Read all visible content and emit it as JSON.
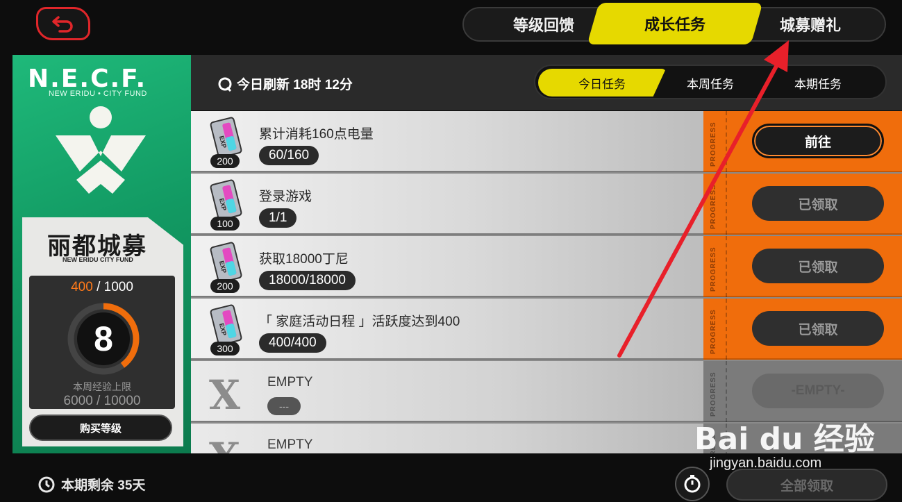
{
  "colors": {
    "accent_yellow": "#e6d900",
    "orange": "#f06d0c",
    "green": "#129a63",
    "arrow_red": "#e8202a"
  },
  "top_tabs": [
    {
      "label": "等级回馈",
      "active": false
    },
    {
      "label": "成长任务",
      "active": true
    },
    {
      "label": "城募赠礼",
      "active": false
    }
  ],
  "left_panel": {
    "logo_title": "N.E.C.F.",
    "logo_subtitle": "NEW ERIDU • CITY FUND",
    "card_title": "丽都城募",
    "card_subtitle": "NEW ERIDU CITY FUND",
    "exp_current": "400",
    "exp_total": "/ 1000",
    "exp_progress": 0.4,
    "level": "8",
    "weekly_label": "本周经验上限",
    "weekly_value": "6000 / 10000",
    "buy_label": "购买等级"
  },
  "header": {
    "refresh_text": "今日刷新 18时 12分",
    "sub_tabs": [
      {
        "label": "今日任务",
        "active": true
      },
      {
        "label": "本周任务",
        "active": false
      },
      {
        "label": "本期任务",
        "active": false
      }
    ]
  },
  "progress_label": "PROGRESS",
  "ticket_text": "EXP",
  "tasks": [
    {
      "name": "累计消耗160点电量",
      "progress": "60/160",
      "reward": "200",
      "action": "前往",
      "state": "go"
    },
    {
      "name": "登录游戏",
      "progress": "1/1",
      "reward": "100",
      "action": "已领取",
      "state": "claimed"
    },
    {
      "name": "获取18000丁尼",
      "progress": "18000/18000",
      "reward": "200",
      "action": "已领取",
      "state": "claimed"
    },
    {
      "name": "「 家庭活动日程 」活跃度达到400",
      "progress": "400/400",
      "reward": "300",
      "action": "已领取",
      "state": "claimed"
    }
  ],
  "empty_slots": [
    {
      "icon": "X",
      "name": "EMPTY",
      "pill": "---",
      "action": "-EMPTY-"
    },
    {
      "icon": "X",
      "name": "EMPTY"
    }
  ],
  "bottom": {
    "remaining": "本期剩余 35天",
    "claim_all": "全部领取"
  },
  "watermark": {
    "brand": "Bai du 经验",
    "url": "jingyan.baidu.com"
  }
}
